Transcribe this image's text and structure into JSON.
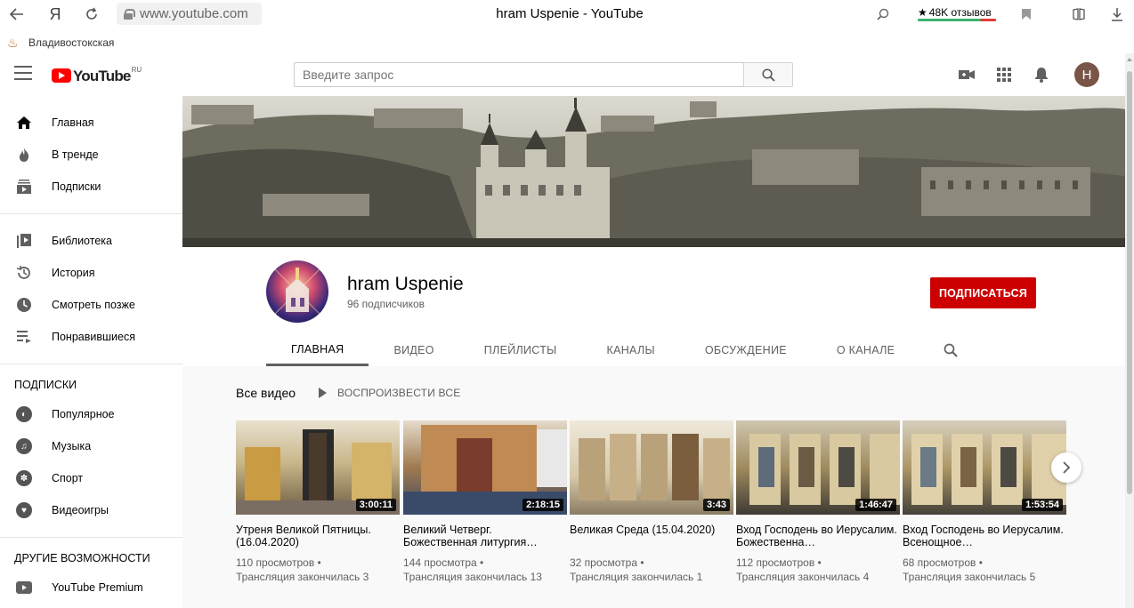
{
  "browser": {
    "url": "www.youtube.com",
    "tab_title": "hram Uspenie - YouTube",
    "reviews": "48K отзывов",
    "bookmark": "Владивостокская"
  },
  "header": {
    "logo_text": "YouTube",
    "logo_region": "RU",
    "search_placeholder": "Введите запрос",
    "avatar_letter": "Н"
  },
  "sidebar": {
    "main": [
      {
        "label": "Главная",
        "icon": "home-icon"
      },
      {
        "label": "В тренде",
        "icon": "flame-icon"
      },
      {
        "label": "Подписки",
        "icon": "subscriptions-icon"
      }
    ],
    "library": [
      {
        "label": "Библиотека",
        "icon": "library-icon"
      },
      {
        "label": "История",
        "icon": "history-icon"
      },
      {
        "label": "Смотреть позже",
        "icon": "clock-icon"
      },
      {
        "label": "Понравившиеся",
        "icon": "playlist-icon"
      }
    ],
    "subs_heading": "ПОДПИСКИ",
    "subs": [
      {
        "label": "Популярное",
        "icon": "popular-icon"
      },
      {
        "label": "Музыка",
        "icon": "music-icon"
      },
      {
        "label": "Спорт",
        "icon": "sport-icon"
      },
      {
        "label": "Видеоигры",
        "icon": "gaming-icon"
      }
    ],
    "more_heading": "ДРУГИЕ ВОЗМОЖНОСТИ",
    "more": [
      {
        "label": "YouTube Premium",
        "icon": "youtube-premium-icon"
      }
    ]
  },
  "channel": {
    "name": "hram Uspenie",
    "subscribers": "96 подписчиков",
    "subscribe_label": "ПОДПИСАТЬСЯ",
    "tabs": [
      "ГЛАВНАЯ",
      "ВИДЕО",
      "ПЛЕЙЛИСТЫ",
      "КАНАЛЫ",
      "ОБСУЖДЕНИЕ",
      "О КАНАЛЕ"
    ],
    "active_tab": "ГЛАВНАЯ"
  },
  "videos_section": {
    "title": "Все видео",
    "play_all": "ВОСПРОИЗВЕСТИ ВСЕ"
  },
  "videos": [
    {
      "title": "Утреня Великой Пятницы. (16.04.2020)",
      "duration": "3:00:11",
      "views": "110 просмотров",
      "meta2": "Трансляция закончилась 3"
    },
    {
      "title": "Великий Четверг. Божественная литургия…",
      "duration": "2:18:15",
      "views": "144 просмотра",
      "meta2": "Трансляция закончилась 13"
    },
    {
      "title": "Великая Среда (15.04.2020)",
      "duration": "3:43",
      "views": "32 просмотра",
      "meta2": "Трансляция закончилась 1"
    },
    {
      "title": "Вход Господень во Иерусалим. Божественна…",
      "duration": "1:46:47",
      "views": "112 просмотров",
      "meta2": "Трансляция закончилась 4"
    },
    {
      "title": "Вход Господень во Иерусалим. Всенощное…",
      "duration": "1:53:54",
      "views": "68 просмотров",
      "meta2": "Трансляция закончилась 5"
    }
  ],
  "colors": {
    "brand_red": "#ff0000",
    "subscribe_red": "#cc0000"
  }
}
